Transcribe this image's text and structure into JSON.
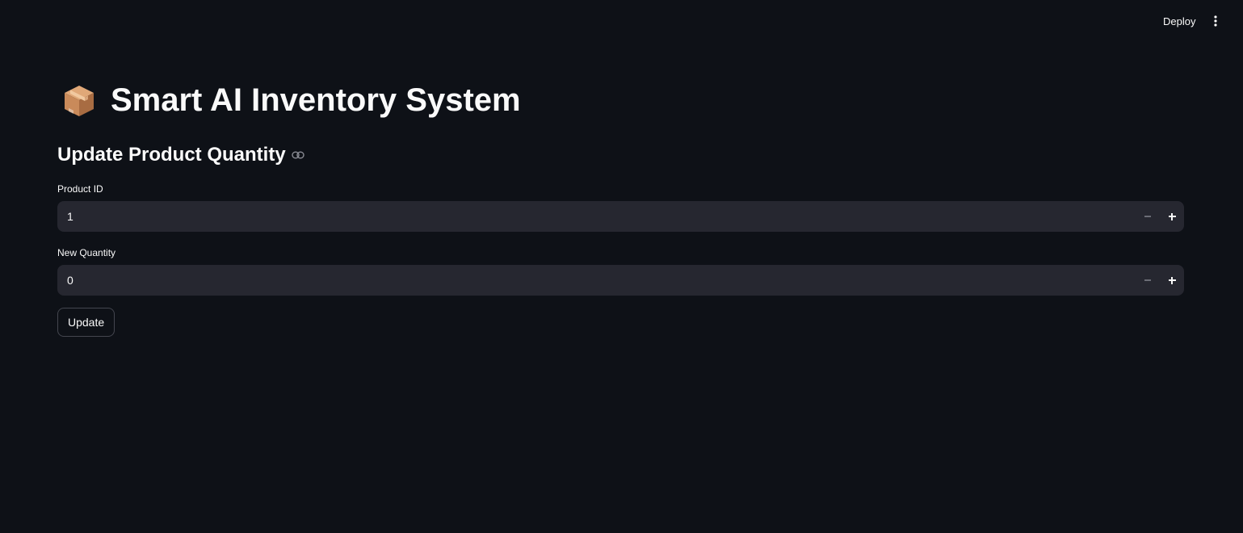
{
  "header": {
    "deploy_label": "Deploy",
    "menu_icon": "vertical-dots-icon"
  },
  "page": {
    "title_icon": "package-box-icon",
    "title": "Smart AI Inventory System",
    "subheader": "Update Product Quantity",
    "subheader_link_icon": "link-icon"
  },
  "form": {
    "product_id": {
      "label": "Product ID",
      "value": "1"
    },
    "new_quantity": {
      "label": "New Quantity",
      "value": "0"
    },
    "submit_label": "Update"
  },
  "colors": {
    "background": "#0e1117",
    "input_background": "#262730",
    "text": "#fafafa",
    "button_border": "#44464f"
  }
}
